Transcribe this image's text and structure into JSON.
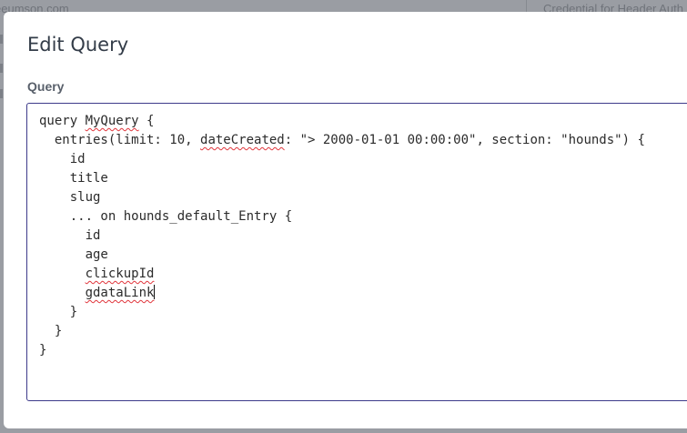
{
  "background": {
    "left_text": "eeumson.com",
    "right_text": "Credential for Header Auth"
  },
  "modal": {
    "title": "Edit Query",
    "field_label": "Query"
  },
  "editor": {
    "lines": [
      {
        "indent": "",
        "parts": [
          {
            "text": "query "
          },
          {
            "text": "MyQuery",
            "flag": true
          },
          {
            "text": " {"
          }
        ]
      },
      {
        "indent": "  ",
        "parts": [
          {
            "text": "entries(limit: 10, "
          },
          {
            "text": "dateCreated",
            "flag": true
          },
          {
            "text": ": \"> 2000-01-01 00:00:00\", section: \"hounds\") {"
          }
        ]
      },
      {
        "indent": "    ",
        "parts": [
          {
            "text": "id"
          }
        ]
      },
      {
        "indent": "    ",
        "parts": [
          {
            "text": "title"
          }
        ]
      },
      {
        "indent": "    ",
        "parts": [
          {
            "text": "slug"
          }
        ]
      },
      {
        "indent": "    ",
        "parts": [
          {
            "text": "... on hounds_default_Entry {"
          }
        ]
      },
      {
        "indent": "      ",
        "parts": [
          {
            "text": "id"
          }
        ]
      },
      {
        "indent": "      ",
        "parts": [
          {
            "text": "age"
          }
        ]
      },
      {
        "indent": "      ",
        "parts": [
          {
            "text": "clickupId",
            "flag": true
          }
        ]
      },
      {
        "indent": "      ",
        "parts": [
          {
            "text": "gdataLink",
            "flag": true
          }
        ],
        "caret": true
      },
      {
        "indent": "    ",
        "parts": [
          {
            "text": "}"
          }
        ]
      },
      {
        "indent": "  ",
        "parts": [
          {
            "text": "}"
          }
        ]
      },
      {
        "indent": "",
        "parts": [
          {
            "text": "}"
          }
        ]
      }
    ]
  },
  "colors": {
    "editor_border": "#3d3a8a",
    "spellcheck_underline": "#e0353b",
    "title_text": "#333c48"
  }
}
